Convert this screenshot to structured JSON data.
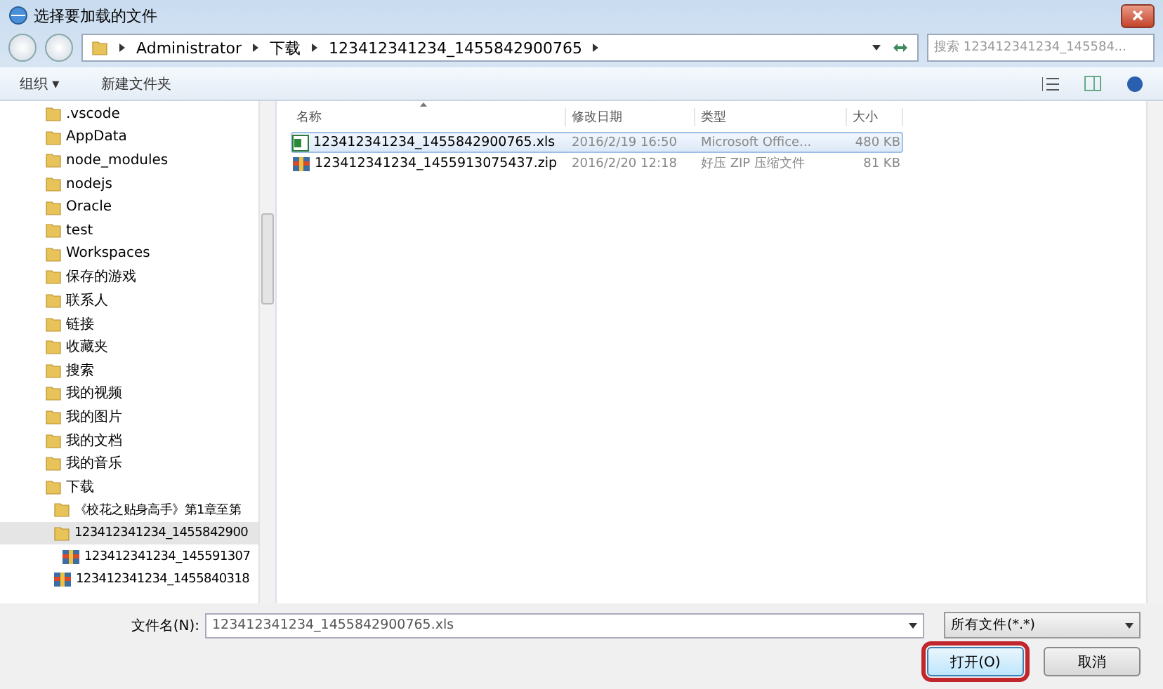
{
  "window": {
    "title": "选择要加载的文件"
  },
  "breadcrumb": [
    "Administrator",
    "下载",
    "123412341234_1455842900765"
  ],
  "search": {
    "placeholder": "搜索 123412341234_145584..."
  },
  "toolbar": [
    "组织 ▾",
    "新建文件夹"
  ],
  "tree": [
    {
      "label": ".vscode",
      "kind": "folder",
      "selected": false
    },
    {
      "label": "AppData",
      "kind": "folder",
      "selected": false
    },
    {
      "label": "node_modules",
      "kind": "folder",
      "selected": false
    },
    {
      "label": "nodejs",
      "kind": "folder",
      "selected": false
    },
    {
      "label": "Oracle",
      "kind": "folder",
      "selected": false
    },
    {
      "label": "test",
      "kind": "folder",
      "selected": false
    },
    {
      "label": "Workspaces",
      "kind": "folder",
      "selected": false
    },
    {
      "label": "保存的游戏",
      "kind": "folder",
      "selected": false
    },
    {
      "label": "联系人",
      "kind": "folder",
      "selected": false
    },
    {
      "label": "链接",
      "kind": "folder",
      "selected": false
    },
    {
      "label": "收藏夹",
      "kind": "folder",
      "selected": false
    },
    {
      "label": "搜索",
      "kind": "folder",
      "selected": false
    },
    {
      "label": "我的视频",
      "kind": "folder",
      "selected": false
    },
    {
      "label": "我的图片",
      "kind": "folder",
      "selected": false
    },
    {
      "label": "我的文档",
      "kind": "folder",
      "selected": false
    },
    {
      "label": "我的音乐",
      "kind": "folder",
      "selected": false
    },
    {
      "label": "下载",
      "kind": "folder",
      "selected": false,
      "children": [
        {
          "label": "《校花之贴身高手》第1章至第",
          "kind": "folder",
          "selected": false
        },
        {
          "label": "123412341234_1455842900",
          "kind": "folder",
          "selected": true,
          "children": [
            {
              "label": "123412341234_145591307",
              "kind": "zip",
              "selected": false
            }
          ]
        },
        {
          "label": "123412341234_1455840318",
          "kind": "zip",
          "selected": false
        }
      ]
    }
  ],
  "files": {
    "columns": [
      "名称",
      "修改日期",
      "类型",
      "大小"
    ],
    "rows": [
      {
        "kind": "xls",
        "selected": true,
        "cells": [
          "123412341234_1455842900765.xls",
          "2016/2/19 16:50",
          "Microsoft Office...",
          "480 KB"
        ]
      },
      {
        "kind": "zip",
        "selected": false,
        "cells": [
          "123412341234_1455913075437.zip",
          "2016/2/20 12:18",
          "好压 ZIP 压缩文件",
          "81 KB"
        ]
      }
    ]
  },
  "filename": {
    "label": "文件名(N):",
    "value": "123412341234_1455842900765.xls"
  },
  "filter": {
    "value": "所有文件(*.*)"
  },
  "buttons": [
    {
      "label": "打开(O)",
      "default": true,
      "highlighted": true
    },
    {
      "label": "取消",
      "default": false,
      "highlighted": false
    }
  ]
}
